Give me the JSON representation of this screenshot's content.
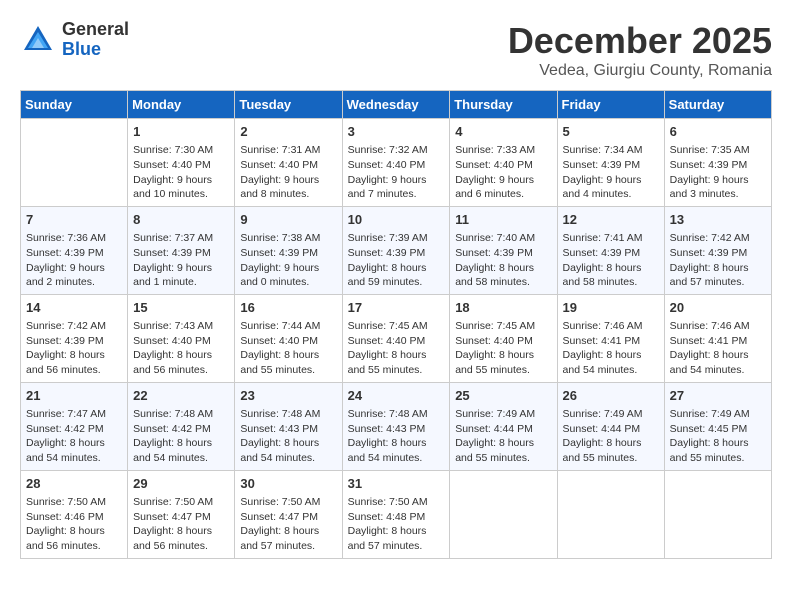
{
  "header": {
    "logo_general": "General",
    "logo_blue": "Blue",
    "month_title": "December 2025",
    "location": "Vedea, Giurgiu County, Romania"
  },
  "days_of_week": [
    "Sunday",
    "Monday",
    "Tuesday",
    "Wednesday",
    "Thursday",
    "Friday",
    "Saturday"
  ],
  "weeks": [
    [
      {
        "day": "",
        "info": ""
      },
      {
        "day": "1",
        "info": "Sunrise: 7:30 AM\nSunset: 4:40 PM\nDaylight: 9 hours\nand 10 minutes."
      },
      {
        "day": "2",
        "info": "Sunrise: 7:31 AM\nSunset: 4:40 PM\nDaylight: 9 hours\nand 8 minutes."
      },
      {
        "day": "3",
        "info": "Sunrise: 7:32 AM\nSunset: 4:40 PM\nDaylight: 9 hours\nand 7 minutes."
      },
      {
        "day": "4",
        "info": "Sunrise: 7:33 AM\nSunset: 4:40 PM\nDaylight: 9 hours\nand 6 minutes."
      },
      {
        "day": "5",
        "info": "Sunrise: 7:34 AM\nSunset: 4:39 PM\nDaylight: 9 hours\nand 4 minutes."
      },
      {
        "day": "6",
        "info": "Sunrise: 7:35 AM\nSunset: 4:39 PM\nDaylight: 9 hours\nand 3 minutes."
      }
    ],
    [
      {
        "day": "7",
        "info": "Sunrise: 7:36 AM\nSunset: 4:39 PM\nDaylight: 9 hours\nand 2 minutes."
      },
      {
        "day": "8",
        "info": "Sunrise: 7:37 AM\nSunset: 4:39 PM\nDaylight: 9 hours\nand 1 minute."
      },
      {
        "day": "9",
        "info": "Sunrise: 7:38 AM\nSunset: 4:39 PM\nDaylight: 9 hours\nand 0 minutes."
      },
      {
        "day": "10",
        "info": "Sunrise: 7:39 AM\nSunset: 4:39 PM\nDaylight: 8 hours\nand 59 minutes."
      },
      {
        "day": "11",
        "info": "Sunrise: 7:40 AM\nSunset: 4:39 PM\nDaylight: 8 hours\nand 58 minutes."
      },
      {
        "day": "12",
        "info": "Sunrise: 7:41 AM\nSunset: 4:39 PM\nDaylight: 8 hours\nand 58 minutes."
      },
      {
        "day": "13",
        "info": "Sunrise: 7:42 AM\nSunset: 4:39 PM\nDaylight: 8 hours\nand 57 minutes."
      }
    ],
    [
      {
        "day": "14",
        "info": "Sunrise: 7:42 AM\nSunset: 4:39 PM\nDaylight: 8 hours\nand 56 minutes."
      },
      {
        "day": "15",
        "info": "Sunrise: 7:43 AM\nSunset: 4:40 PM\nDaylight: 8 hours\nand 56 minutes."
      },
      {
        "day": "16",
        "info": "Sunrise: 7:44 AM\nSunset: 4:40 PM\nDaylight: 8 hours\nand 55 minutes."
      },
      {
        "day": "17",
        "info": "Sunrise: 7:45 AM\nSunset: 4:40 PM\nDaylight: 8 hours\nand 55 minutes."
      },
      {
        "day": "18",
        "info": "Sunrise: 7:45 AM\nSunset: 4:40 PM\nDaylight: 8 hours\nand 55 minutes."
      },
      {
        "day": "19",
        "info": "Sunrise: 7:46 AM\nSunset: 4:41 PM\nDaylight: 8 hours\nand 54 minutes."
      },
      {
        "day": "20",
        "info": "Sunrise: 7:46 AM\nSunset: 4:41 PM\nDaylight: 8 hours\nand 54 minutes."
      }
    ],
    [
      {
        "day": "21",
        "info": "Sunrise: 7:47 AM\nSunset: 4:42 PM\nDaylight: 8 hours\nand 54 minutes."
      },
      {
        "day": "22",
        "info": "Sunrise: 7:48 AM\nSunset: 4:42 PM\nDaylight: 8 hours\nand 54 minutes."
      },
      {
        "day": "23",
        "info": "Sunrise: 7:48 AM\nSunset: 4:43 PM\nDaylight: 8 hours\nand 54 minutes."
      },
      {
        "day": "24",
        "info": "Sunrise: 7:48 AM\nSunset: 4:43 PM\nDaylight: 8 hours\nand 54 minutes."
      },
      {
        "day": "25",
        "info": "Sunrise: 7:49 AM\nSunset: 4:44 PM\nDaylight: 8 hours\nand 55 minutes."
      },
      {
        "day": "26",
        "info": "Sunrise: 7:49 AM\nSunset: 4:44 PM\nDaylight: 8 hours\nand 55 minutes."
      },
      {
        "day": "27",
        "info": "Sunrise: 7:49 AM\nSunset: 4:45 PM\nDaylight: 8 hours\nand 55 minutes."
      }
    ],
    [
      {
        "day": "28",
        "info": "Sunrise: 7:50 AM\nSunset: 4:46 PM\nDaylight: 8 hours\nand 56 minutes."
      },
      {
        "day": "29",
        "info": "Sunrise: 7:50 AM\nSunset: 4:47 PM\nDaylight: 8 hours\nand 56 minutes."
      },
      {
        "day": "30",
        "info": "Sunrise: 7:50 AM\nSunset: 4:47 PM\nDaylight: 8 hours\nand 57 minutes."
      },
      {
        "day": "31",
        "info": "Sunrise: 7:50 AM\nSunset: 4:48 PM\nDaylight: 8 hours\nand 57 minutes."
      },
      {
        "day": "",
        "info": ""
      },
      {
        "day": "",
        "info": ""
      },
      {
        "day": "",
        "info": ""
      }
    ]
  ]
}
